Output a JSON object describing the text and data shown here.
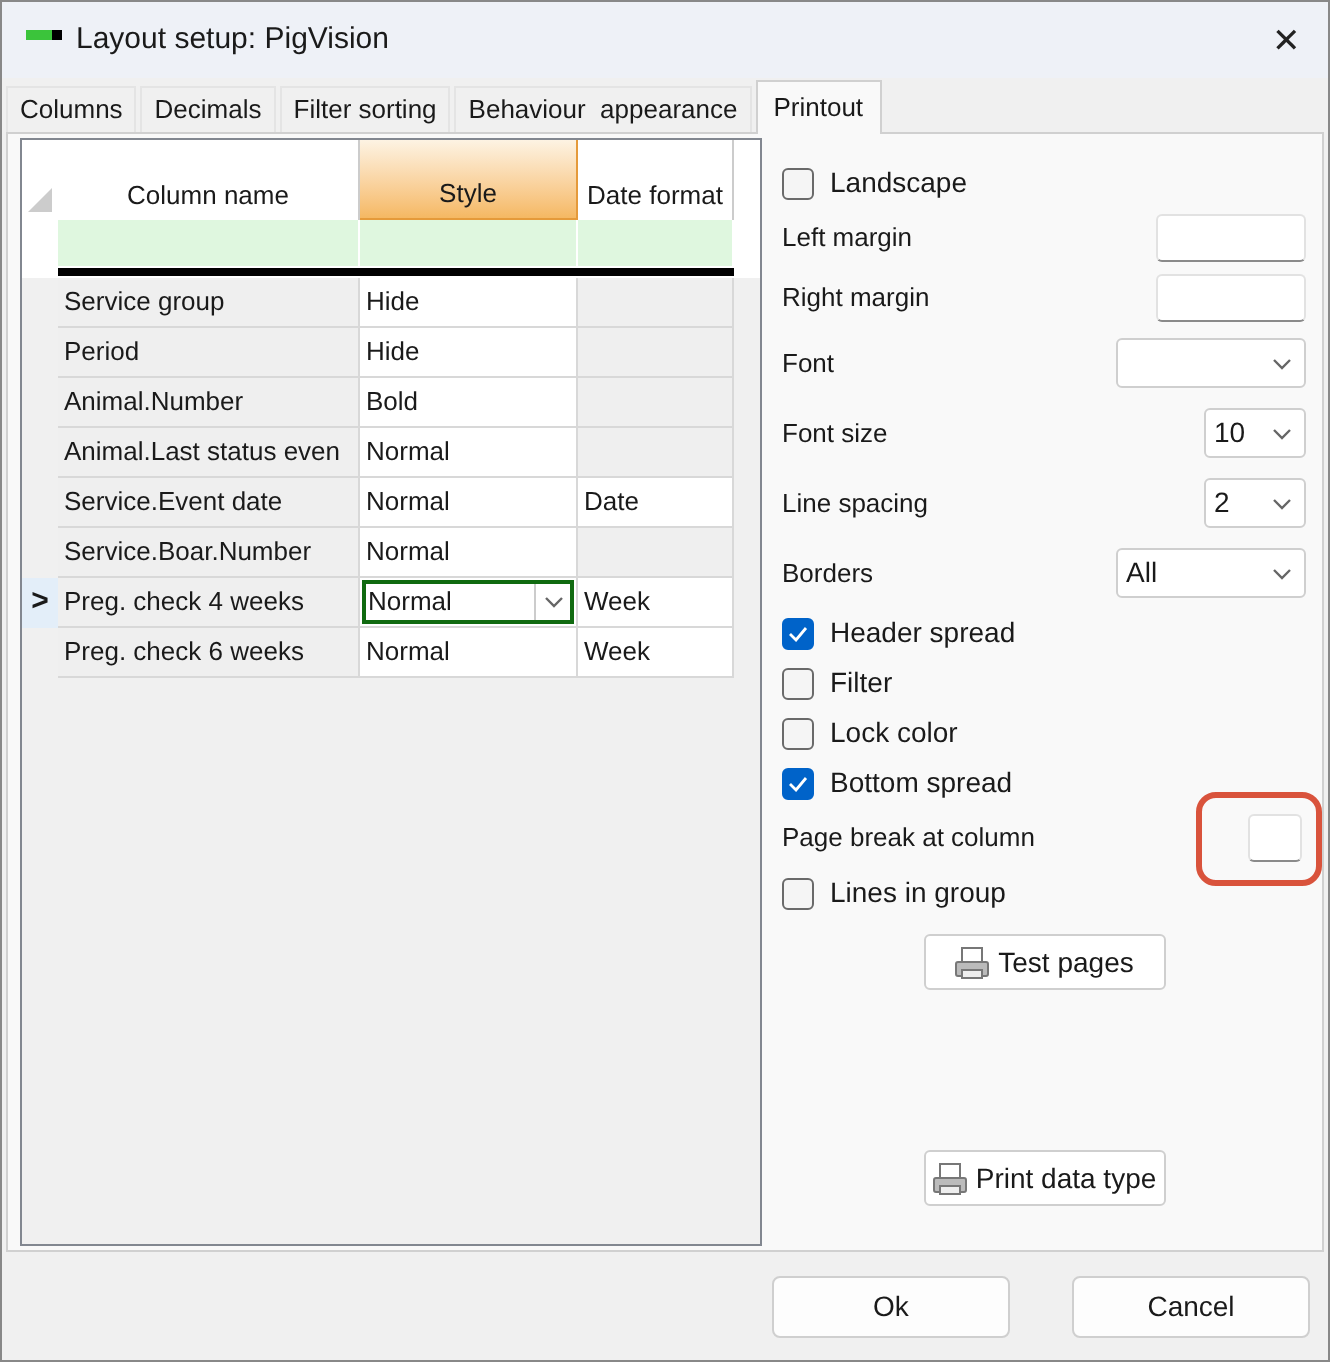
{
  "window": {
    "title": "Layout setup: PigVision",
    "close": "✕"
  },
  "tabs": [
    {
      "label": "Columns",
      "selected": false
    },
    {
      "label": "Decimals",
      "selected": false
    },
    {
      "label": "Filter sorting",
      "selected": false
    },
    {
      "label": "Behaviour  appearance",
      "selected": false
    },
    {
      "label": "Printout",
      "selected": true
    }
  ],
  "grid": {
    "columns": [
      {
        "label": "Column name",
        "sorted": false
      },
      {
        "label": "Style",
        "sorted": true
      },
      {
        "label": "Date format",
        "sorted": false
      }
    ],
    "rows": [
      {
        "name": "Service group",
        "style": "Hide",
        "current": false
      },
      {
        "name": "Period",
        "style": "Hide",
        "current": false
      },
      {
        "name": "Animal.Number",
        "style": "Bold",
        "current": false
      },
      {
        "name": "Animal.Last status even",
        "style": "Normal",
        "current": false
      },
      {
        "name": "Service.Event date",
        "style": "Normal",
        "date_format": "Date",
        "current": false
      },
      {
        "name": "Service.Boar.Number",
        "style": "Normal",
        "current": false
      },
      {
        "name": "Preg. check 4 weeks",
        "style": "Normal",
        "date_format": "Week",
        "current": true,
        "current_marker": ">"
      },
      {
        "name": "Preg. check 6 weeks",
        "style": "Normal",
        "date_format": "Week",
        "current": false
      }
    ]
  },
  "options": [
    {
      "kind": "checkbox",
      "label": "Landscape",
      "checked": false
    },
    {
      "kind": "text",
      "label": "Left margin"
    },
    {
      "kind": "text",
      "label": "Right margin"
    },
    {
      "kind": "dropdown",
      "label": "Font"
    },
    {
      "kind": "small_dropdown",
      "label": "Font size",
      "value": "10"
    },
    {
      "kind": "small_dropdown",
      "label": "Line spacing",
      "value": "2"
    },
    {
      "kind": "dropdown",
      "label": "Borders",
      "value": "All"
    },
    {
      "kind": "checkbox",
      "label": "Header spread",
      "checked": true
    },
    {
      "kind": "checkbox",
      "label": "Filter",
      "checked": false
    },
    {
      "kind": "checkbox",
      "label": "Lock color",
      "checked": false
    },
    {
      "kind": "checkbox",
      "label": "Bottom spread",
      "checked": true
    },
    {
      "kind": "small_text",
      "label": "Page break at column",
      "highlighted": true
    },
    {
      "kind": "checkbox",
      "label": "Lines in group",
      "checked": false
    }
  ],
  "side_buttons": [
    "Test pages",
    "Print data type"
  ],
  "buttons": [
    "Ok",
    "Cancel"
  ]
}
